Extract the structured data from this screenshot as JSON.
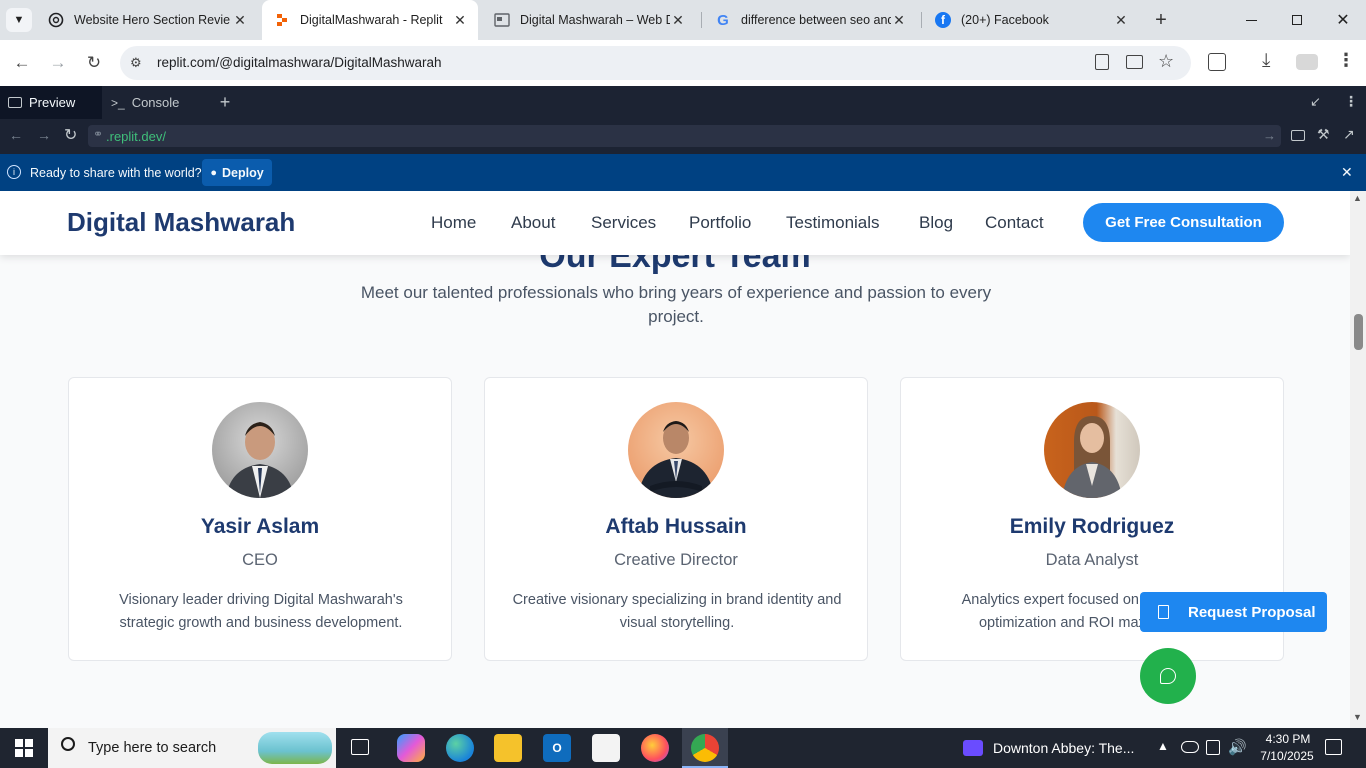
{
  "browser": {
    "tabs": [
      {
        "title": "Website Hero Section Revie",
        "icon": "chatgpt-icon",
        "active": false
      },
      {
        "title": "DigitalMashwarah - Replit",
        "icon": "replit-icon",
        "active": true
      },
      {
        "title": "Digital Mashwarah – Web De",
        "icon": "page-icon",
        "active": false
      },
      {
        "title": "difference between seo and",
        "icon": "google-icon",
        "active": false
      },
      {
        "title": "(20+) Facebook",
        "icon": "facebook-icon",
        "active": false
      }
    ],
    "url": "replit.com/@digitalmashwara/DigitalMashwarah"
  },
  "replit": {
    "preview_tab": "Preview",
    "console_tab": "Console",
    "preview_url": ".replit.dev/",
    "banner_text": "Ready to share with the world?",
    "deploy_label": "Deploy"
  },
  "site": {
    "logo": "Digital Mashwarah",
    "nav": [
      "Home",
      "About",
      "Services",
      "Portfolio",
      "Testimonials",
      "Blog",
      "Contact"
    ],
    "cta": "Get Free Consultation",
    "section_title": "Our Expert Team",
    "intro": "Meet our talented professionals who bring years of experience and passion to every project.",
    "team": [
      {
        "name": "Yasir Aslam",
        "role": "CEO",
        "desc": "Visionary leader driving Digital Mashwarah's strategic growth and business development."
      },
      {
        "name": "Aftab Hussain",
        "role": "Creative Director",
        "desc": "Creative visionary specializing in brand identity and visual storytelling."
      },
      {
        "name": "Emily Rodriguez",
        "role": "Data Analyst",
        "desc": "Analytics expert focused on performance optimization and ROI maximization."
      }
    ],
    "request_proposal": "Request Proposal"
  },
  "taskbar": {
    "search_placeholder": "Type here to search",
    "media_title": "Downton Abbey: The...",
    "time": "4:30 PM",
    "date": "7/10/2025"
  }
}
